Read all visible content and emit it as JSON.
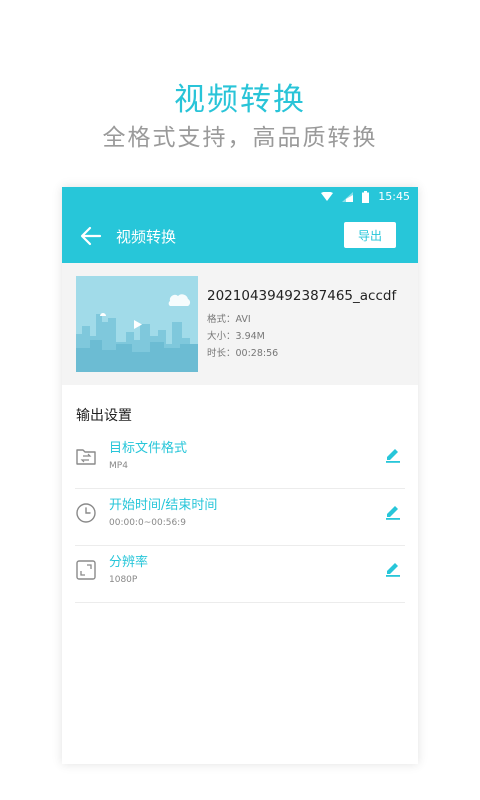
{
  "promo": {
    "title": "视频转换",
    "subtitle": "全格式支持，高品质转换"
  },
  "status_bar": {
    "time": "15:45",
    "icons": [
      "wifi-icon",
      "signal-icon",
      "battery-icon"
    ]
  },
  "app_bar": {
    "back_icon": "arrow-left-icon",
    "title": "视频转换",
    "export_label": "导出"
  },
  "file": {
    "name": "20210439492387465_accdf",
    "format": "格式：AVI",
    "size": "大小：3.94M",
    "duration": "时长：00:28:56"
  },
  "output_settings": {
    "title": "输出设置",
    "items": [
      {
        "icon": "folder-convert-icon",
        "label": "目标文件格式",
        "value": "MP4"
      },
      {
        "icon": "clock-icon",
        "label": "开始时间/结束时间",
        "value": "00:00:0~00:56:9"
      },
      {
        "icon": "resolution-icon",
        "label": "分辨率",
        "value": "1080P"
      }
    ]
  },
  "colors": {
    "accent": "#27c6d9",
    "promo_title": "#29c4d8",
    "promo_subtitle": "#9a9a9a"
  }
}
